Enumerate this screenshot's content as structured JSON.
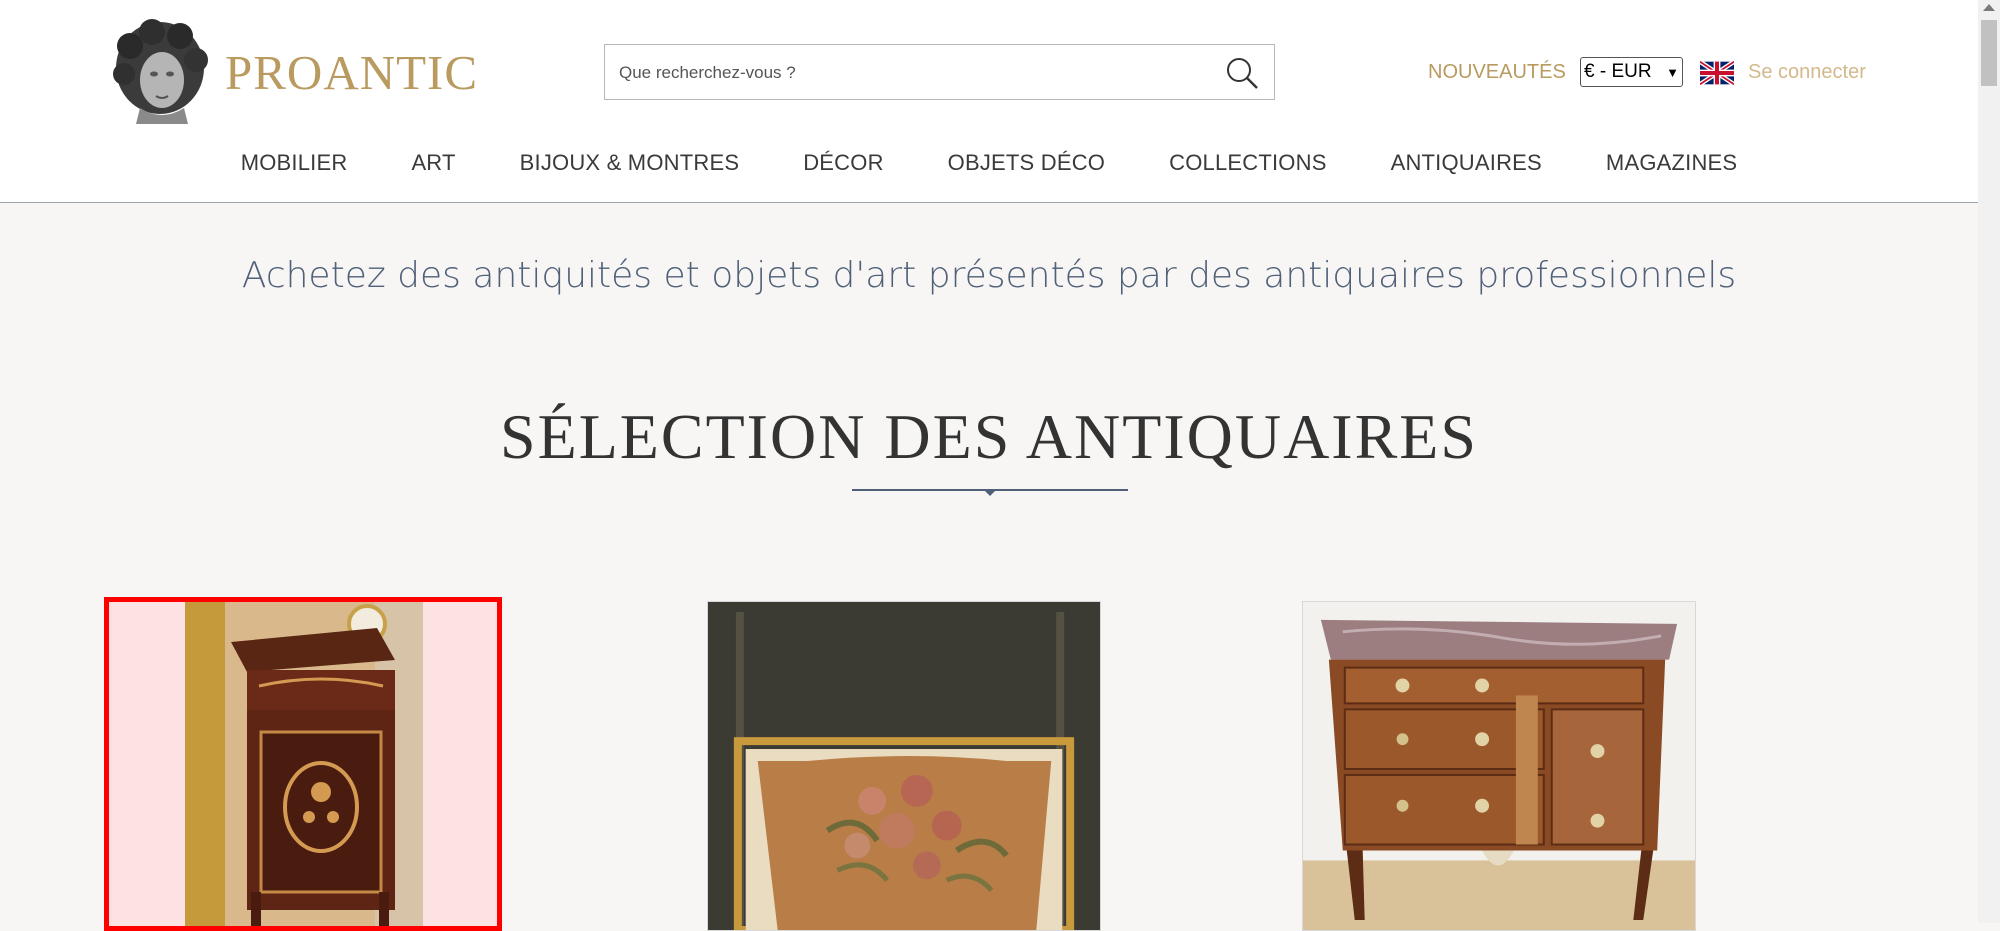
{
  "header": {
    "logo_text": "PROANTIC",
    "search": {
      "placeholder": "Que recherchez-vous ?"
    },
    "nouveautes": "NOUVEAUTÉS",
    "currency": "€ - EUR",
    "login": "Se connecter"
  },
  "nav": {
    "items": [
      "MOBILIER",
      "ART",
      "BIJOUX & MONTRES",
      "DÉCOR",
      "OBJETS DÉCO",
      "COLLECTIONS",
      "ANTIQUAIRES",
      "MAGAZINES"
    ]
  },
  "main": {
    "tagline": "Achetez des antiquités et objets d'art présentés par des antiquaires professionnels",
    "section_title": "SÉLECTION DES ANTIQUAIRES"
  },
  "colors": {
    "gold": "#b99a5f",
    "slate": "#4f6078",
    "highlight": "#ff0000"
  }
}
